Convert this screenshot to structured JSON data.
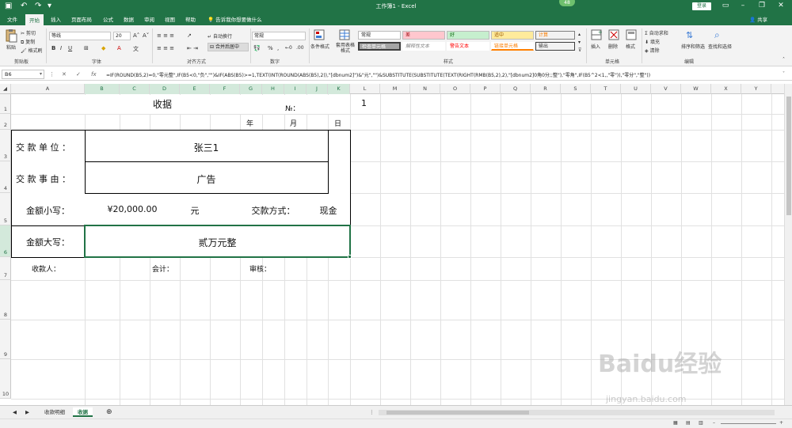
{
  "window": {
    "title": "工作簿1 - Excel",
    "badge": "48",
    "login_label": "登录",
    "icons": [
      "save-icon",
      "undo-icon",
      "redo-icon",
      "minimize-icon",
      "restore-icon",
      "close-icon"
    ]
  },
  "ribbon_tabs": [
    "文件",
    "开始",
    "插入",
    "页面布局",
    "公式",
    "数据",
    "审阅",
    "视图",
    "帮助"
  ],
  "active_tab": "开始",
  "tell_me": "告诉我你想要做什么",
  "share_label": "共享",
  "ribbon": {
    "clipboard": {
      "paste": "粘贴",
      "cut": "剪切",
      "copy": "复制",
      "format_painter": "格式刷",
      "label": "剪贴板"
    },
    "font": {
      "name": "等线",
      "size": "20",
      "label": "字体"
    },
    "alignment": {
      "wrap": "自动换行",
      "merge": "合并后居中",
      "label": "对齐方式"
    },
    "number": {
      "format": "常规",
      "label": "数字"
    },
    "styles": {
      "conditional": "条件格式",
      "table_format": "套用表格格式",
      "cells": [
        {
          "text": "常规",
          "bg": "#ffffff",
          "color": "#222222"
        },
        {
          "text": "差",
          "bg": "#ffc7ce",
          "color": "#9c0006"
        },
        {
          "text": "好",
          "bg": "#c6efce",
          "color": "#006100"
        },
        {
          "text": "适中",
          "bg": "#ffeb9c",
          "color": "#9c5700"
        },
        {
          "text": "计算",
          "bg": "#f2f2f2",
          "color": "#fa7d00"
        },
        {
          "text": "检查单元格",
          "bg": "#a5a5a5",
          "color": "#ffffff"
        },
        {
          "text": "解释性文本",
          "bg": "#ffffff",
          "color": "#7f7f7f"
        },
        {
          "text": "警告文本",
          "bg": "#ffffff",
          "color": "#ff0000"
        },
        {
          "text": "链接单元格",
          "bg": "#ffffff",
          "color": "#fa7d00"
        },
        {
          "text": "输出",
          "bg": "#f2f2f2",
          "color": "#3f3f3f"
        }
      ],
      "label": "样式"
    },
    "cells": {
      "insert": "插入",
      "delete": "删除",
      "format": "格式",
      "label": "单元格"
    },
    "editing": {
      "autosum": "自动求和",
      "fill": "填充",
      "clear": "清除",
      "sort": "排序和筛选",
      "find": "查找和选择",
      "label": "编辑"
    }
  },
  "name_box": "B6",
  "formula_bar": {
    "fx": "fx",
    "formula": "=IF(ROUND(B5,2)=0,\"零元整\",IF(B5<0,\"负\",\"\")&IF(ABS(B5)>=1,TEXT(INT(ROUND(ABS(B5),2)),\"[dbnum2]\")&\"元\",\"\")&SUBSTITUTE(SUBSTITUTE(TEXT(RIGHT(RMB(B5,2),2),\"[dbnum2]0角0分;;整\"),\"零角\",IF(B5^2<1,,\"零\")),\"零分\",\"整\"))"
  },
  "columns": [
    "A",
    "B",
    "C",
    "D",
    "E",
    "F",
    "G",
    "H",
    "I",
    "J",
    "K",
    "L",
    "M",
    "N",
    "O",
    "P",
    "Q",
    "R",
    "S",
    "T",
    "U",
    "V",
    "W",
    "X",
    "Y"
  ],
  "rows": [
    "1",
    "2",
    "3",
    "4",
    "5",
    "6",
    "7",
    "8",
    "9",
    "10"
  ],
  "sheet": {
    "title": "收据",
    "no_label": "№：",
    "l1": "1",
    "year": "年",
    "month": "月",
    "day": "日",
    "payer_label": "交 款 单 位 ：",
    "payer_value": "张三1",
    "reason_label": "交 款 事 由 ：",
    "reason_value": "广告",
    "lower_label": "金额小写：",
    "lower_value": "¥20,000.00",
    "unit": "元",
    "method_label": "交款方式：",
    "method_value": "现金",
    "upper_label": "金额大写：",
    "upper_value": "贰万元整",
    "receiver": "收款人：",
    "accountant": "会计：",
    "auditor": "审核："
  },
  "sheet_tabs": [
    "收款明细",
    "收据"
  ],
  "active_sheet": "收据",
  "watermark": {
    "text": "Baidu经验",
    "url": "jingyan.baidu.com"
  }
}
